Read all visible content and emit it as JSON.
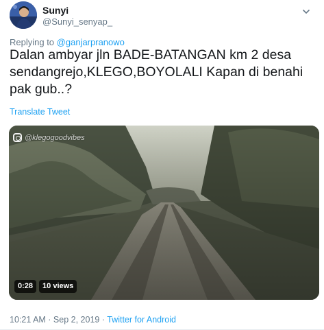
{
  "tweet": {
    "author": {
      "display_name": "Sunyi",
      "handle": "@Sunyi_senyap_",
      "avatar_icon": "profile-avatar"
    },
    "reply": {
      "prefix": "Replying to",
      "target": "@ganjarpranowo"
    },
    "text": "Dalan ambyar jln BADE-BATANGAN km 2 desa sendangrejo,KLEGO,BOYOLALI Kapan di benahi pak gub..?",
    "translate_label": "Translate Tweet",
    "video": {
      "watermark": "@klegogoodvibes",
      "duration": "0:28",
      "views": "10 views"
    },
    "timestamp": "10:21 AM · Sep 2, 2019",
    "separator": " · ",
    "source": "Twitter for Android"
  },
  "colors": {
    "link": "#1da1f2",
    "secondary_text": "#657786",
    "primary_text": "#14171a"
  }
}
